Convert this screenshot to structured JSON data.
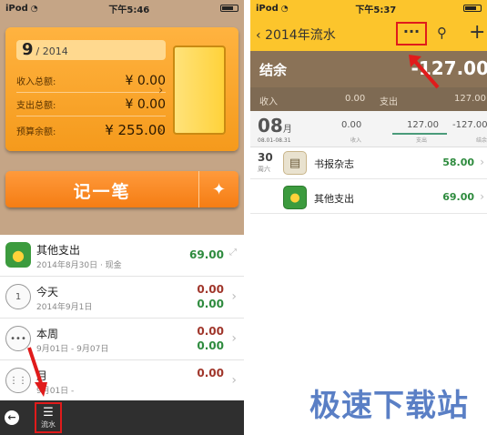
{
  "left": {
    "status": {
      "carrier": "iPod",
      "time": "下午5:46"
    },
    "card": {
      "month": "9",
      "year": "/ 2014",
      "income_label": "收入总额:",
      "income_value": "¥ 0.00",
      "expense_label": "支出总额:",
      "expense_value": "¥ 0.00",
      "budget_label": "预算余额:",
      "budget_value": "¥ 255.00"
    },
    "record_button": "记一笔",
    "items": [
      {
        "name": "其他支出",
        "sub": "2014年8月30日 · 现金",
        "amount": "69.00"
      },
      {
        "name": "今天",
        "sub": "2014年9月1日",
        "amount_top": "0.00",
        "amount_bottom": "0.00",
        "icon_text": "1"
      },
      {
        "name": "本周",
        "sub": "9月01日 - 9月07日",
        "amount_top": "0.00",
        "amount_bottom": "0.00"
      },
      {
        "name": "月",
        "sub": "9月01日 -",
        "amount_top": "0.00"
      }
    ],
    "tabbar": {
      "tab_label": "流水"
    }
  },
  "right": {
    "status": {
      "carrier": "iPod",
      "time": "下午5:37"
    },
    "nav": {
      "back": "2014年流水",
      "more": "···",
      "plus": "+"
    },
    "balance": {
      "label": "结余",
      "value": "-127.00"
    },
    "summary": {
      "income_label": "收入",
      "income_value": "0.00",
      "expense_label": "支出",
      "expense_value": "127.00"
    },
    "month": {
      "num": "08",
      "unit": "月",
      "range": "08.01-08.31",
      "income": "0.00",
      "income_label": "收入",
      "expense": "127.00",
      "expense_label": "支出",
      "balance": "-127.00",
      "balance_label": "结余"
    },
    "items": [
      {
        "day": "30",
        "weekday": "周六",
        "name": "书报杂志",
        "amount": "58.00"
      },
      {
        "name": "其他支出",
        "amount": "69.00"
      }
    ]
  },
  "watermark": "极速下载站"
}
